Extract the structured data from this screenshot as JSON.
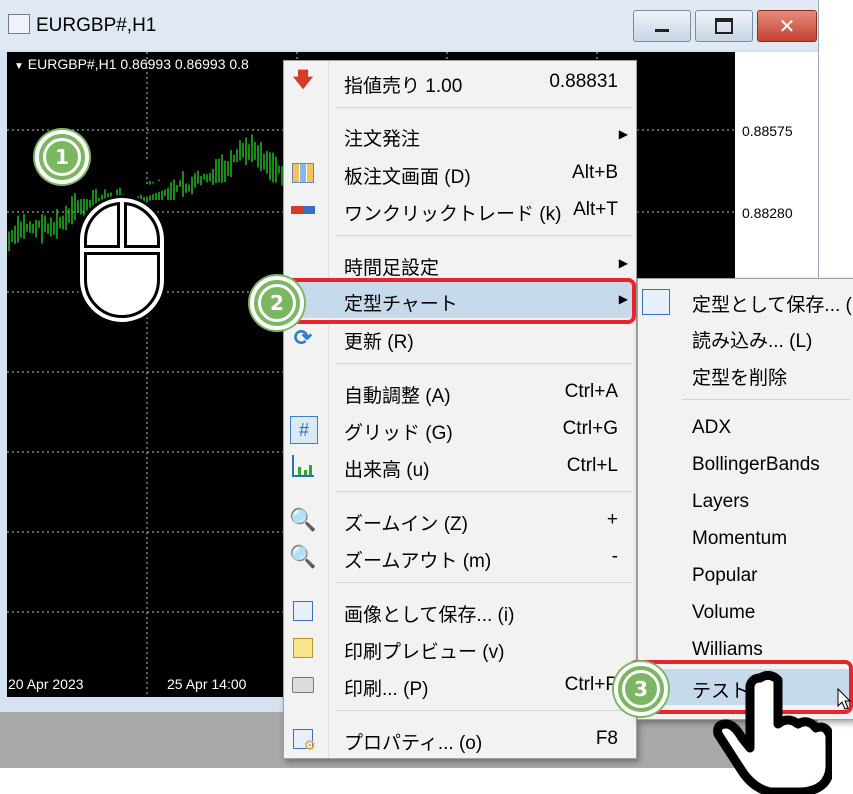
{
  "window": {
    "title": "EURGBP#,H1"
  },
  "chart": {
    "header": "EURGBP#,H1  0.86993 0.86993 0.8",
    "price_labels": [
      "0.88575",
      "0.88280"
    ],
    "time_labels": [
      "20 Apr 2023",
      "25 Apr 14:00"
    ],
    "background_color": "#000000",
    "candle_color": "#22c722"
  },
  "context_menu": {
    "items": [
      {
        "label": "指値売り 1.00",
        "shortcut": "0.88831",
        "icon": "sell-arrow-icon"
      },
      {
        "label": "注文発注",
        "shortcut": "",
        "icon": ""
      },
      {
        "label": "板注文画面 (D)",
        "shortcut": "Alt+B",
        "icon": "depth-of-market-icon"
      },
      {
        "label": "ワンクリックトレード (k)",
        "shortcut": "Alt+T",
        "icon": "one-click-trading-icon"
      },
      {
        "label": "時間足設定",
        "shortcut": "",
        "icon": ""
      },
      {
        "label": "定型チャート",
        "shortcut": "",
        "icon": ""
      },
      {
        "label": "更新 (R)",
        "shortcut": "",
        "icon": "refresh-icon"
      },
      {
        "label": "自動調整 (A)",
        "shortcut": "Ctrl+A",
        "icon": ""
      },
      {
        "label": "グリッド (G)",
        "shortcut": "Ctrl+G",
        "icon": "grid-icon"
      },
      {
        "label": "出来高 (u)",
        "shortcut": "Ctrl+L",
        "icon": "volumes-icon"
      },
      {
        "label": "ズームイン (Z)",
        "shortcut": "+",
        "icon": "zoom-in-icon"
      },
      {
        "label": "ズームアウト (m)",
        "shortcut": "-",
        "icon": "zoom-out-icon"
      },
      {
        "label": "画像として保存... (i)",
        "shortcut": "",
        "icon": "save-picture-icon"
      },
      {
        "label": "印刷プレビュー (v)",
        "shortcut": "",
        "icon": "print-preview-icon"
      },
      {
        "label": "印刷... (P)",
        "shortcut": "Ctrl+P",
        "icon": "print-icon"
      },
      {
        "label": "プロパティ... (o)",
        "shortcut": "F8",
        "icon": "properties-icon"
      }
    ]
  },
  "template_submenu": {
    "items": [
      {
        "label": "定型として保存... (S"
      },
      {
        "label": "読み込み... (L)"
      },
      {
        "label": "定型を削除"
      },
      {
        "label": "ADX"
      },
      {
        "label": "BollingerBands"
      },
      {
        "label": "Layers"
      },
      {
        "label": "Momentum"
      },
      {
        "label": "Popular"
      },
      {
        "label": "Volume"
      },
      {
        "label": "Williams"
      },
      {
        "label": "テスト"
      }
    ]
  },
  "callouts": {
    "step1": "1",
    "step2": "2",
    "step3": "3",
    "highlight_color": "#e8242c",
    "badge_color": "#7bb661"
  }
}
